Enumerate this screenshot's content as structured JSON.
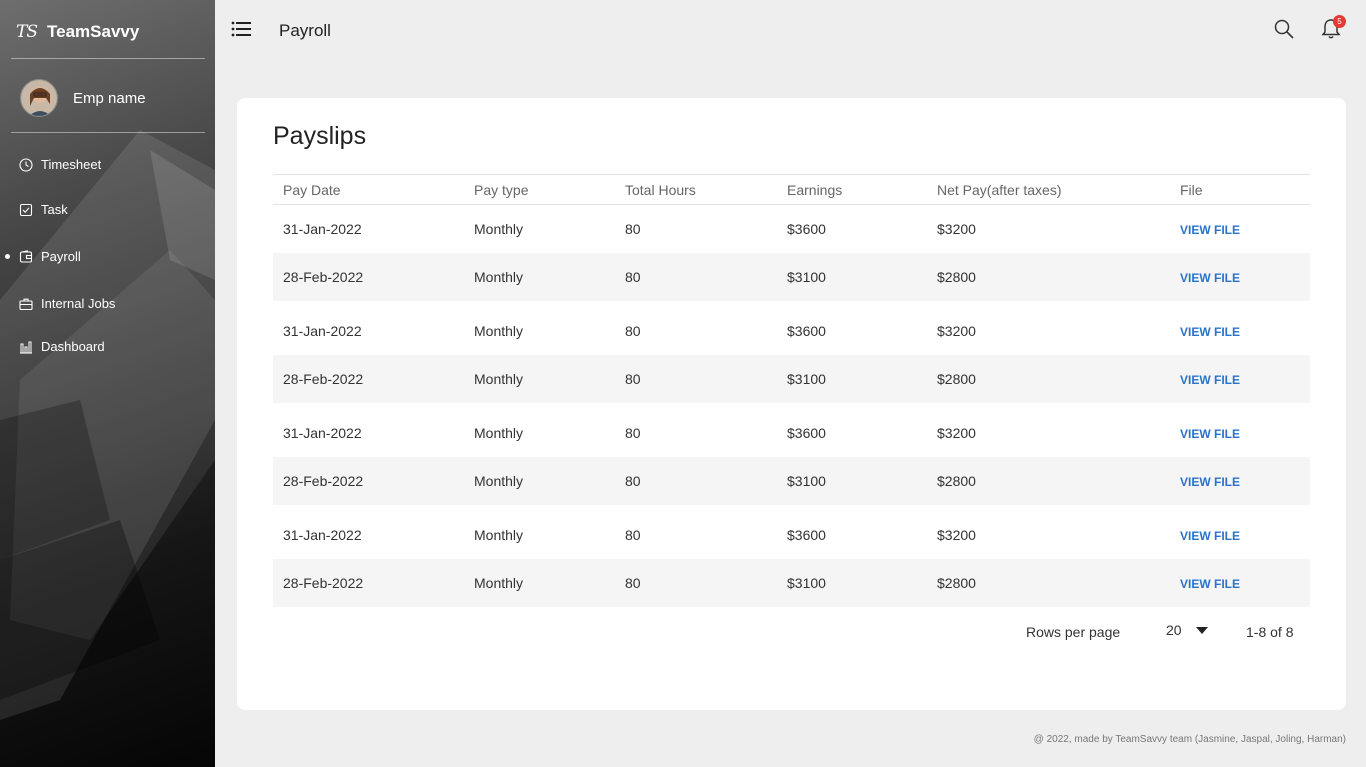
{
  "brand": {
    "logo": "TS",
    "name": "TeamSavvy"
  },
  "user": {
    "name": "Emp name"
  },
  "sidebar": {
    "items": [
      {
        "label": "Timesheet",
        "icon": "clock-icon",
        "active": false
      },
      {
        "label": "Task",
        "icon": "checklist-icon",
        "active": false
      },
      {
        "label": "Payroll",
        "icon": "payroll-icon",
        "active": true
      },
      {
        "label": "Internal Jobs",
        "icon": "briefcase-icon",
        "active": false
      },
      {
        "label": "Dashboard",
        "icon": "bar-chart-icon",
        "active": false
      }
    ]
  },
  "header": {
    "title": "Payroll",
    "notification_count": "5"
  },
  "main": {
    "title": "Payslips",
    "columns": [
      "Pay Date",
      "Pay type",
      "Total Hours",
      "Earnings",
      "Net Pay(after taxes)",
      "File"
    ],
    "rows": [
      {
        "date": "31-Jan-2022",
        "type": "Monthly",
        "hours": "80",
        "earnings": "$3600",
        "net": "$3200",
        "file": "VIEW FILE"
      },
      {
        "date": "28-Feb-2022",
        "type": "Monthly",
        "hours": "80",
        "earnings": "$3100",
        "net": "$2800",
        "file": "VIEW FILE"
      },
      {
        "date": "31-Jan-2022",
        "type": "Monthly",
        "hours": "80",
        "earnings": "$3600",
        "net": "$3200",
        "file": "VIEW FILE"
      },
      {
        "date": "28-Feb-2022",
        "type": "Monthly",
        "hours": "80",
        "earnings": "$3100",
        "net": "$2800",
        "file": "VIEW FILE"
      },
      {
        "date": "31-Jan-2022",
        "type": "Monthly",
        "hours": "80",
        "earnings": "$3600",
        "net": "$3200",
        "file": "VIEW FILE"
      },
      {
        "date": "28-Feb-2022",
        "type": "Monthly",
        "hours": "80",
        "earnings": "$3100",
        "net": "$2800",
        "file": "VIEW FILE"
      },
      {
        "date": "31-Jan-2022",
        "type": "Monthly",
        "hours": "80",
        "earnings": "$3600",
        "net": "$3200",
        "file": "VIEW FILE"
      },
      {
        "date": "28-Feb-2022",
        "type": "Monthly",
        "hours": "80",
        "earnings": "$3100",
        "net": "$2800",
        "file": "VIEW FILE"
      }
    ],
    "pagination": {
      "rows_per_page_label": "Rows per page",
      "rows_per_page": "20",
      "range": "1-8 of 8"
    }
  },
  "footer": {
    "text": "@ 2022, made by TeamSavvy team (Jasmine, Jaspal, Joling, Harman)"
  },
  "colors": {
    "link": "#2a73c8",
    "badge": "#e53935",
    "background": "#eeeeee"
  }
}
